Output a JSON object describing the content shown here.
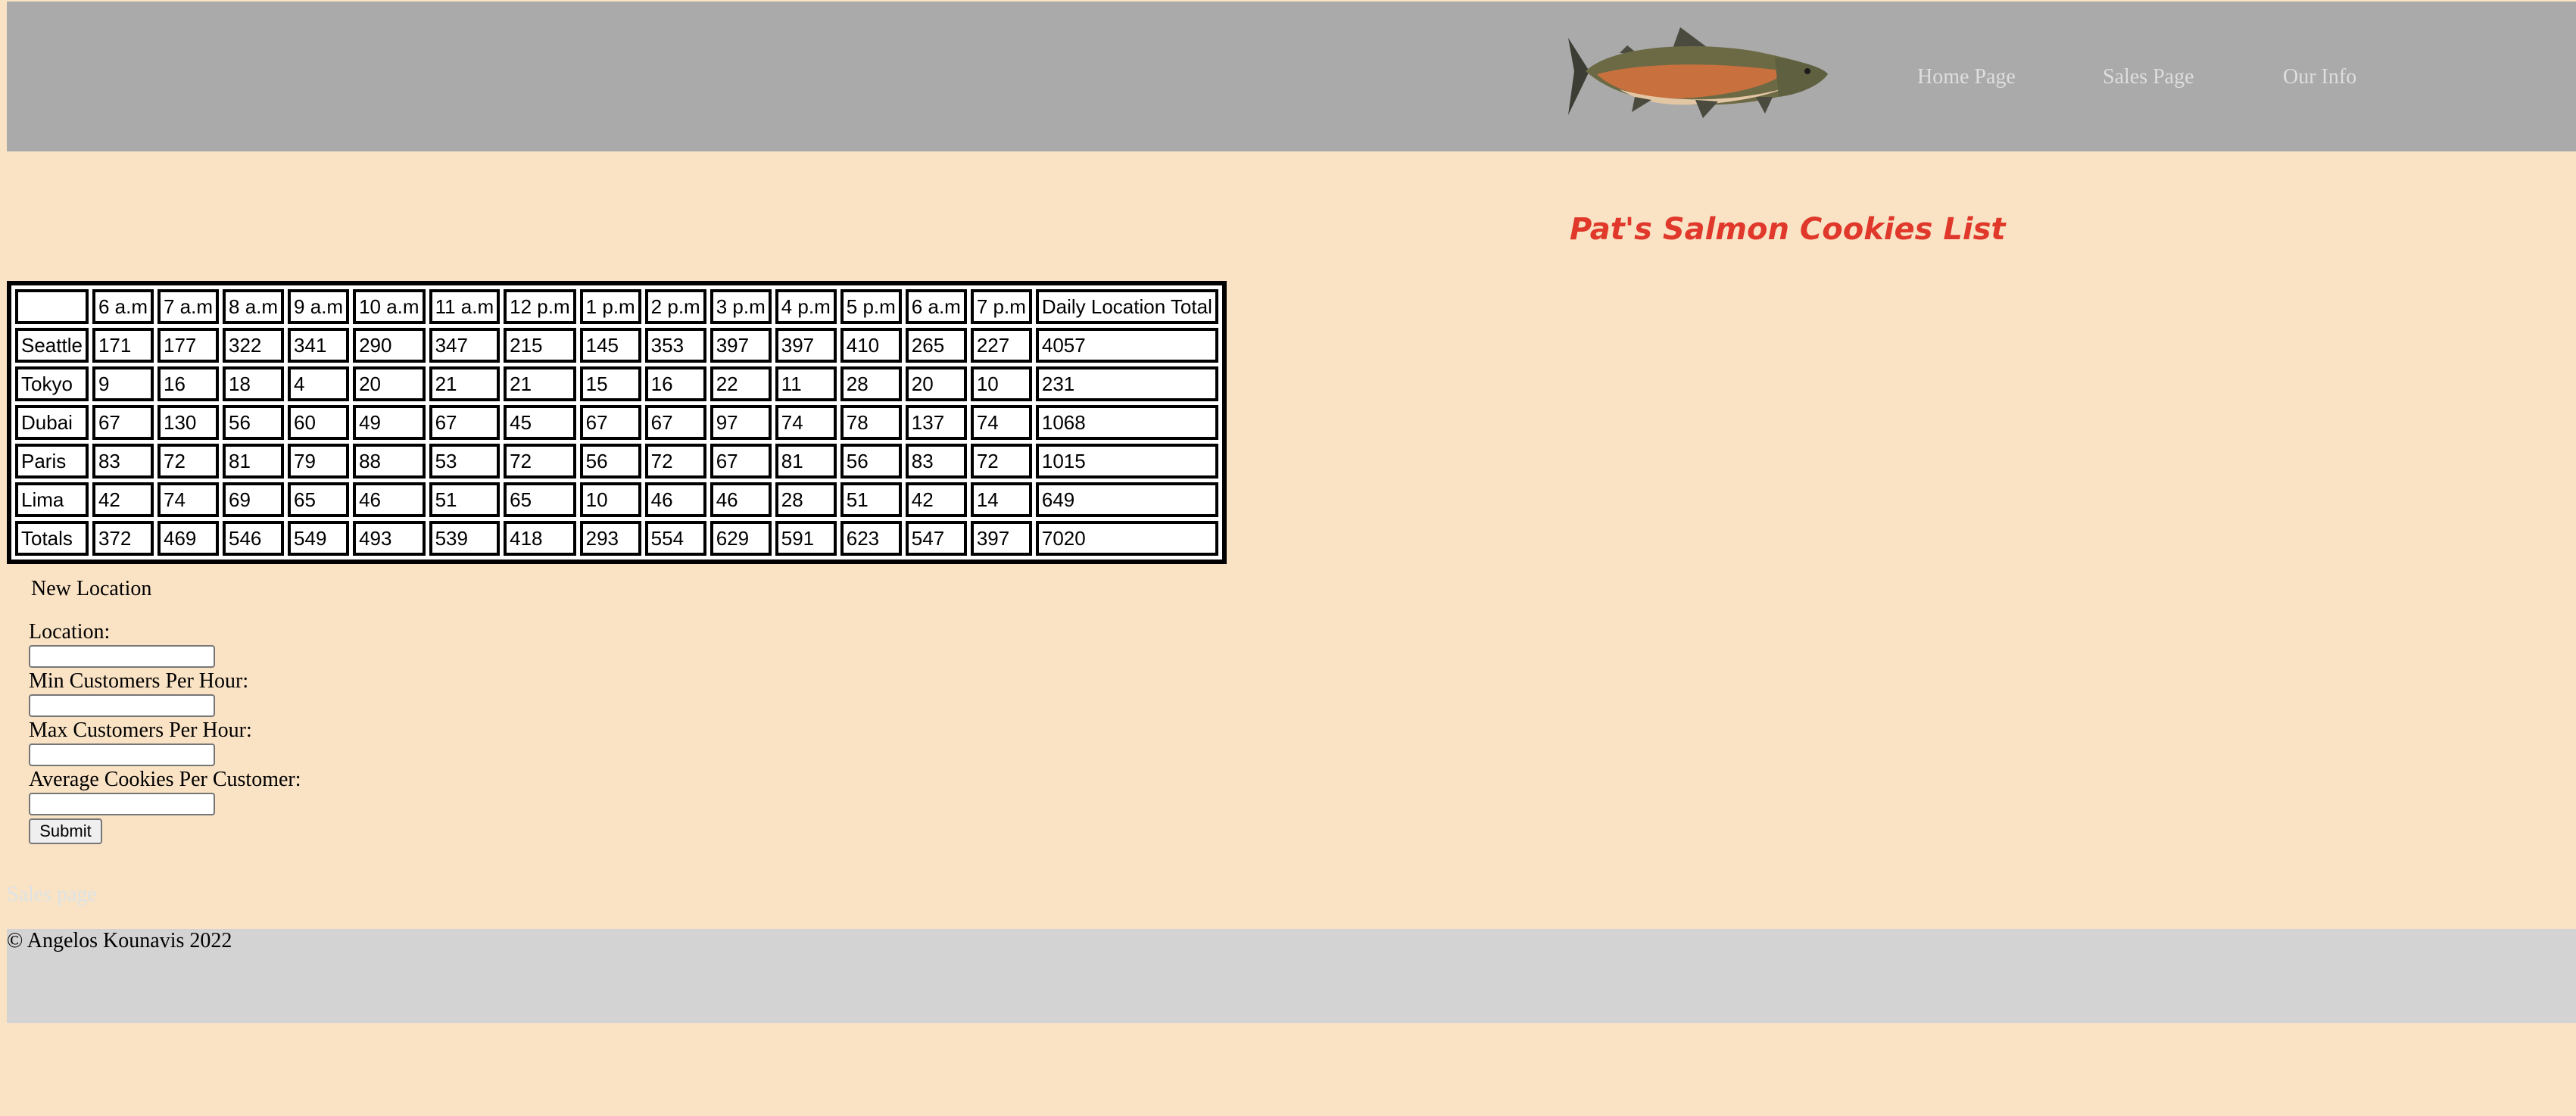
{
  "nav": {
    "links": [
      "Home Page",
      "Sales Page",
      "Our Info"
    ]
  },
  "logo_icon": "salmon-fish-image",
  "title": "Pat's Salmon Cookies List",
  "table": {
    "headers": [
      "",
      "6 a.m",
      "7 a.m",
      "8 a.m",
      "9 a.m",
      "10 a.m",
      "11 a.m",
      "12 p.m",
      "1 p.m",
      "2 p.m",
      "3 p.m",
      "4 p.m",
      "5 p.m",
      "6 a.m",
      "7 p.m",
      "Daily Location Total"
    ],
    "rows": [
      [
        "Seattle",
        "171",
        "177",
        "322",
        "341",
        "290",
        "347",
        "215",
        "145",
        "353",
        "397",
        "397",
        "410",
        "265",
        "227",
        "4057"
      ],
      [
        "Tokyo",
        "9",
        "16",
        "18",
        "4",
        "20",
        "21",
        "21",
        "15",
        "16",
        "22",
        "11",
        "28",
        "20",
        "10",
        "231"
      ],
      [
        "Dubai",
        "67",
        "130",
        "56",
        "60",
        "49",
        "67",
        "45",
        "67",
        "67",
        "97",
        "74",
        "78",
        "137",
        "74",
        "1068"
      ],
      [
        "Paris",
        "83",
        "72",
        "81",
        "79",
        "88",
        "53",
        "72",
        "56",
        "72",
        "67",
        "81",
        "56",
        "83",
        "72",
        "1015"
      ],
      [
        "Lima",
        "42",
        "74",
        "69",
        "65",
        "46",
        "51",
        "65",
        "10",
        "46",
        "46",
        "28",
        "51",
        "42",
        "14",
        "649"
      ],
      [
        "Totals",
        "372",
        "469",
        "546",
        "549",
        "493",
        "539",
        "418",
        "293",
        "554",
        "629",
        "591",
        "623",
        "547",
        "397",
        "7020"
      ]
    ]
  },
  "form": {
    "legend": "New Location",
    "location_label": "Location:",
    "location_value": "",
    "min_label": "Min Customers Per Hour:",
    "min_value": "",
    "max_label": "Max Customers Per Hour:",
    "max_value": "",
    "avg_label": "Average Cookies Per Customer:",
    "avg_value": "",
    "submit_label": "Submit"
  },
  "faded_link": "Sales page",
  "footer": {
    "copyright": "© Angelos Kounavis 2022"
  },
  "colors": {
    "background": "#fae3c5",
    "header": "#aaaaaa",
    "footer": "#d3d3d3",
    "title": "#e0382b",
    "nav_text": "#dedede"
  }
}
